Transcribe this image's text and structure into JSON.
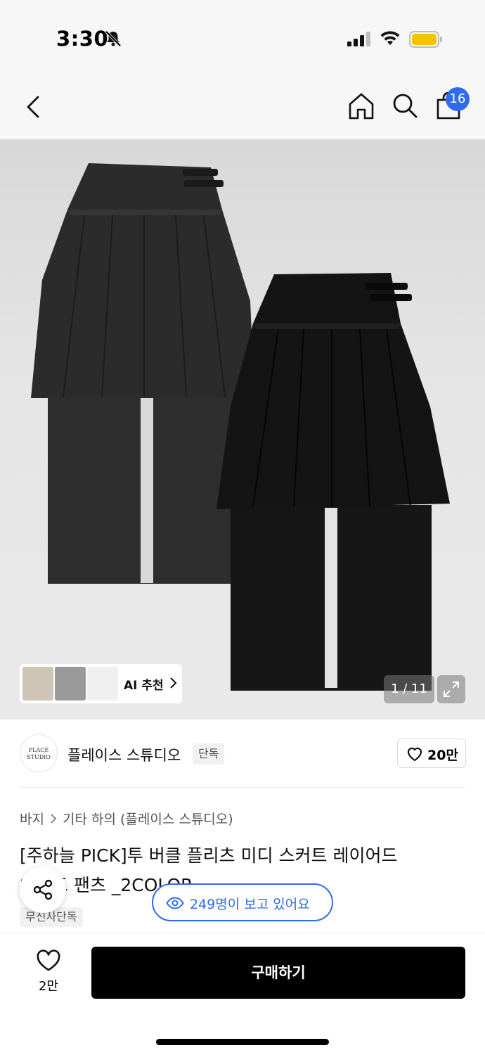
{
  "status_bar": {
    "time": "3:30"
  },
  "header": {
    "cart_count": "16"
  },
  "gallery": {
    "counter": "1 / 11",
    "ai_recommend_label": "AI 추천"
  },
  "brand": {
    "name": "플레이스 스튜디오",
    "exclusive_tag": "단독",
    "like_count": "20만"
  },
  "breadcrumb": [
    "바지",
    "기타 하의 (플레이스 스튜디오)"
  ],
  "product": {
    "title_line1": "[주하늘 PICK]투 버클 플리츠 미디 스커트 레이어드",
    "title_line2": "와이드 팬츠 _2COLOR",
    "store_tag": "무신사단독"
  },
  "viewers": {
    "text": "249명이 보고 있어요"
  },
  "bottom": {
    "wish_count": "2만",
    "buy_label": "구매하기"
  },
  "colors": {
    "accent": "#2f6bed",
    "buy_button": "#000000"
  }
}
